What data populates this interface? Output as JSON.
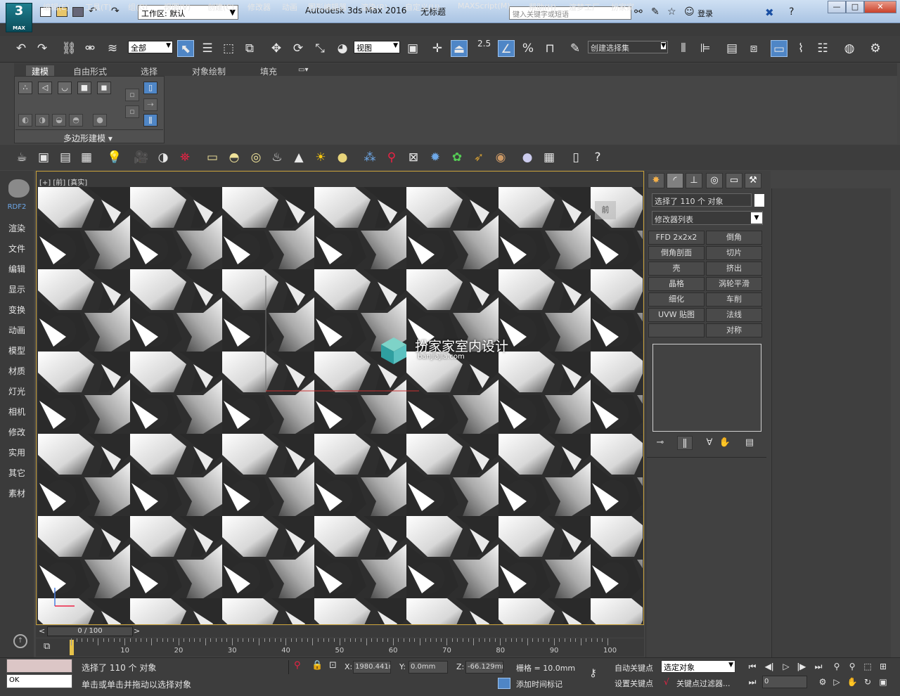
{
  "titlebar": {
    "app_title": "Autodesk 3ds Max 2016",
    "doc_title": "无标题",
    "logo_text": "3",
    "logo_sub": "MAX",
    "workspace_label": "工作区: 默认",
    "search_placeholder": "键入关键字或短语",
    "login_label": "登录"
  },
  "menu": {
    "items": [
      "编辑(E)",
      "工具(T)",
      "组(G)",
      "视图(V)",
      "创建(C)",
      "修改器",
      "动画",
      "图形编辑器",
      "渲染(R)",
      "自定义(U)",
      "MAXScript(M)",
      "帮助(H)",
      "渲梦工厂",
      "扮家家"
    ]
  },
  "main_toolbar": {
    "selection_filter": "全部",
    "reference_coord": "视图",
    "snap_value": "2.5",
    "named_selection": "创建选择集"
  },
  "ribbon": {
    "tabs": [
      "建模",
      "自由形式",
      "选择",
      "对象绘制",
      "填充"
    ],
    "active_tab": "建模",
    "panel_label": "多边形建模"
  },
  "left_sidebar": {
    "plugin_label": "RDF2",
    "tabs": [
      "渲染",
      "文件",
      "编辑",
      "显示",
      "变换",
      "动画",
      "模型",
      "材质",
      "灯光",
      "相机",
      "修改",
      "实用",
      "其它",
      "素材"
    ]
  },
  "viewport": {
    "label": "[+] [前] [真实]",
    "viewcube_label": "前",
    "watermark_text": "扮家家室内设计",
    "watermark_sub": "banjiajia.com"
  },
  "timeline": {
    "slider_label": "0 / 100",
    "ticks": [
      "10",
      "20",
      "30",
      "40",
      "50",
      "60",
      "70",
      "80",
      "90",
      "100"
    ]
  },
  "command_panel": {
    "selection_text": "选择了 110 个 对象",
    "modifier_list": "修改器列表",
    "modifier_buttons": [
      [
        "FFD 2x2x2",
        "倒角"
      ],
      [
        "倒角剖面",
        "切片"
      ],
      [
        "壳",
        "挤出"
      ],
      [
        "晶格",
        "涡轮平滑"
      ],
      [
        "细化",
        "车削"
      ],
      [
        "UVW 贴图",
        "法线"
      ],
      [
        "",
        "对称"
      ]
    ]
  },
  "status": {
    "ok_text": "OK",
    "selection_status": "选择了 110 个 对象",
    "prompt_text": "单击或单击并拖动以选择对象",
    "x_label": "X:",
    "x_value": "1980.441mm",
    "y_label": "Y:",
    "y_value": "0.0mm",
    "z_label": "Z:",
    "z_value": "-66.129mm",
    "grid_text": "栅格 = 10.0mm",
    "auto_key": "自动关键点",
    "set_key": "设置关键点",
    "selected_object": "选定对象",
    "key_filter": "关键点过滤器...",
    "add_time_tag": "添加时间标记",
    "frame_value": "0"
  },
  "colors": {
    "accent": "#4f86c6",
    "viewport_border": "#c8a13a"
  }
}
